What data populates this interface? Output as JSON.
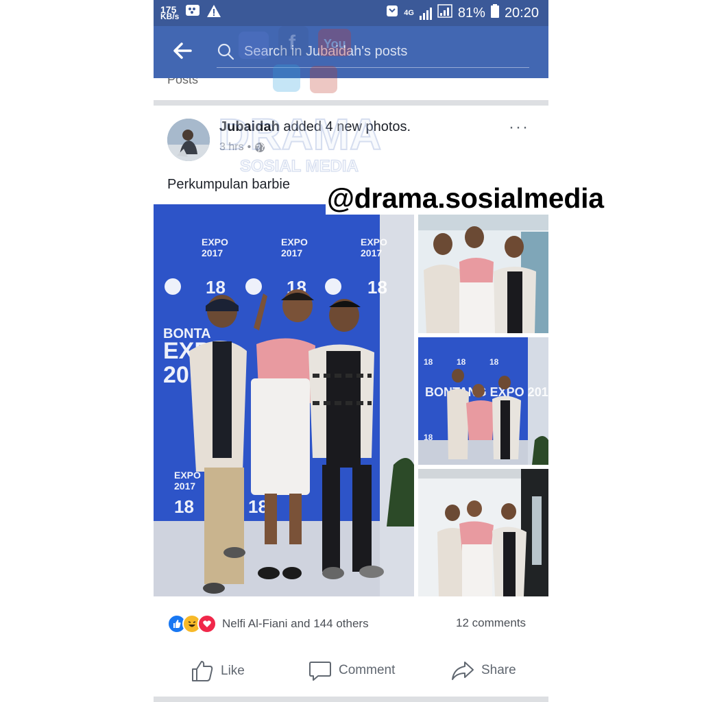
{
  "status_bar": {
    "speed_value": "175",
    "speed_unit": "KB/s",
    "network": "4G",
    "battery": "81%",
    "time": "20:20"
  },
  "header": {
    "search_placeholder": "Search in Jubaidah's posts",
    "strip_text": "Posts"
  },
  "post": {
    "author": "Jubaidah",
    "action_text": "added 4 new photos.",
    "time": "3 hrs",
    "caption": "Perkumpulan barbie",
    "more_label": "···",
    "photos": {
      "main_expo": "BONTANG EXPO 2017",
      "main_badge": "18"
    }
  },
  "reactions": {
    "names": "Nelfi Al-Fiani and 144 others",
    "comments": "12 comments"
  },
  "actions": {
    "like": "Like",
    "comment": "Comment",
    "share": "Share"
  },
  "watermark": {
    "title": "DRAMA",
    "subtitle": "SOSIAL MEDIA",
    "handle": "@drama.sosialmedia"
  },
  "colors": {
    "fb_blue": "#4267b2",
    "status_blue": "#3b5998",
    "backdrop_blue": "#2d54c8",
    "like_blue": "#1877f2",
    "love_red": "#f0284a",
    "haha_yellow": "#f7b928"
  }
}
